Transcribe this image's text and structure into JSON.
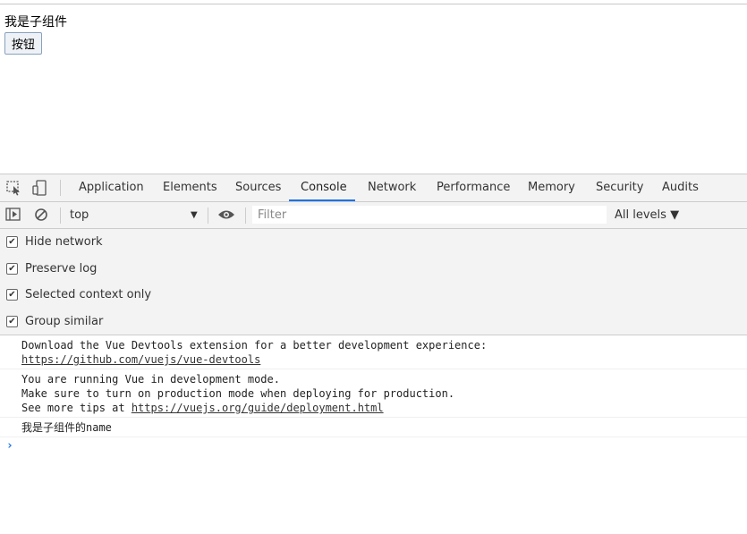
{
  "page": {
    "child_text": "我是子组件",
    "button_label": "按钮"
  },
  "devtools": {
    "tabs": [
      "Application",
      "Elements",
      "Sources",
      "Console",
      "Network",
      "Performance",
      "Memory",
      "Security",
      "Audits"
    ],
    "active_tab": "Console",
    "toolbar": {
      "context": "top",
      "filter_placeholder": "Filter",
      "levels": "All levels ▼"
    },
    "settings": [
      {
        "label": "Hide network",
        "checked": true
      },
      {
        "label": "Preserve log",
        "checked": true
      },
      {
        "label": "Selected context only",
        "checked": true
      },
      {
        "label": "Group similar",
        "checked": true
      }
    ],
    "messages": {
      "m1_line1": "Download the Vue Devtools extension for a better development experience:",
      "m1_link": "https://github.com/vuejs/vue-devtools",
      "m2_line1": "You are running Vue in development mode.",
      "m2_line2": "Make sure to turn on production mode when deploying for production.",
      "m2_line3_prefix": "See more tips at ",
      "m2_link": "https://vuejs.org/guide/deployment.html",
      "m3": "我是子组件的name"
    },
    "prompt_symbol": "›"
  }
}
